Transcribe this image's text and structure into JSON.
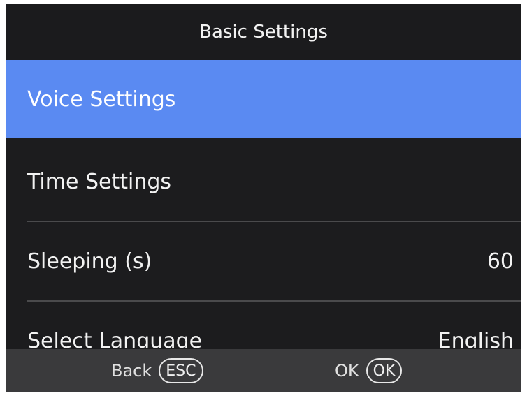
{
  "header": {
    "title": "Basic Settings"
  },
  "menu": {
    "items": [
      {
        "label": "Voice Settings",
        "value": "",
        "selected": true
      },
      {
        "label": "Time Settings",
        "value": "",
        "selected": false
      },
      {
        "label": "Sleeping (s)",
        "value": "60",
        "selected": false
      },
      {
        "label": "Select Language",
        "value": "English",
        "selected": false
      }
    ]
  },
  "footer": {
    "back_label": "Back",
    "back_key": "ESC",
    "ok_label": "OK",
    "ok_key": "OK"
  },
  "colors": {
    "background": "#1c1c1e",
    "selected": "#5a8af2",
    "footer": "#3a3a3c",
    "divider": "#4a4a4c",
    "text": "#f2f2f2"
  }
}
